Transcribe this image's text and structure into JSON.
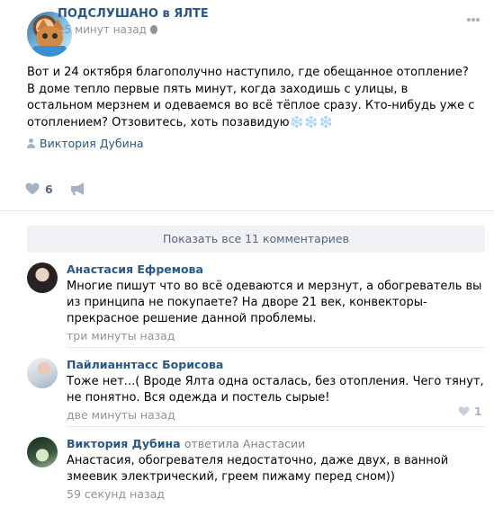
{
  "post": {
    "group_name": "ПОДСЛУШАНО в ЯЛТЕ",
    "time": "15 минут назад",
    "text_main": "Вот и 24 октября благополучно наступило, где обещанное отопление? В доме тепло первые пять минут, когда заходишь с улицы, в остальном мерзнем и одеваемся во всё тёплое сразу. Кто-нибудь уже с отоплением? Отзовитесь, хоть позавидую",
    "snowflakes": "❄️❄️❄️",
    "author_sign": "Виктория Дубина",
    "likes": "6",
    "show_all": "Показать все 11 комментариев"
  },
  "comments": [
    {
      "author": "Анастасия Ефремова",
      "reply_to": "",
      "text": "Многие пишут что во всё одеваются и мерзнут, а обогреватель вы из принципа не покупаете? На дворе 21 век, конвекторы- прекрасное решение данной проблемы.",
      "time": "три минуты назад",
      "likes": ""
    },
    {
      "author": "Пайлианнтасс Борисова",
      "reply_to": "",
      "text": "Тоже нет...( Вроде Ялта одна осталась, без отопления. Чего тянут, не понятно. Вся одежда и постель сырые!",
      "time": "две минуты назад",
      "likes": "1"
    },
    {
      "author": "Виктория Дубина",
      "reply_to": "ответила Анастасии",
      "text": "Анастасия, обогревателя недостаточно, даже двух, в ванной змеевик электрический, греем пижаму перед сном))",
      "time": "59 секунд назад",
      "likes": ""
    }
  ],
  "colors": {
    "link": "#2a5885",
    "muted": "#939393",
    "icon": "#a2b3c6",
    "divider": "#e7e8ec",
    "button_bg": "#f0f2f5"
  },
  "icons": [
    "group-avatar",
    "apple-icon",
    "more-icon",
    "user-icon",
    "heart-icon",
    "share-icon"
  ]
}
